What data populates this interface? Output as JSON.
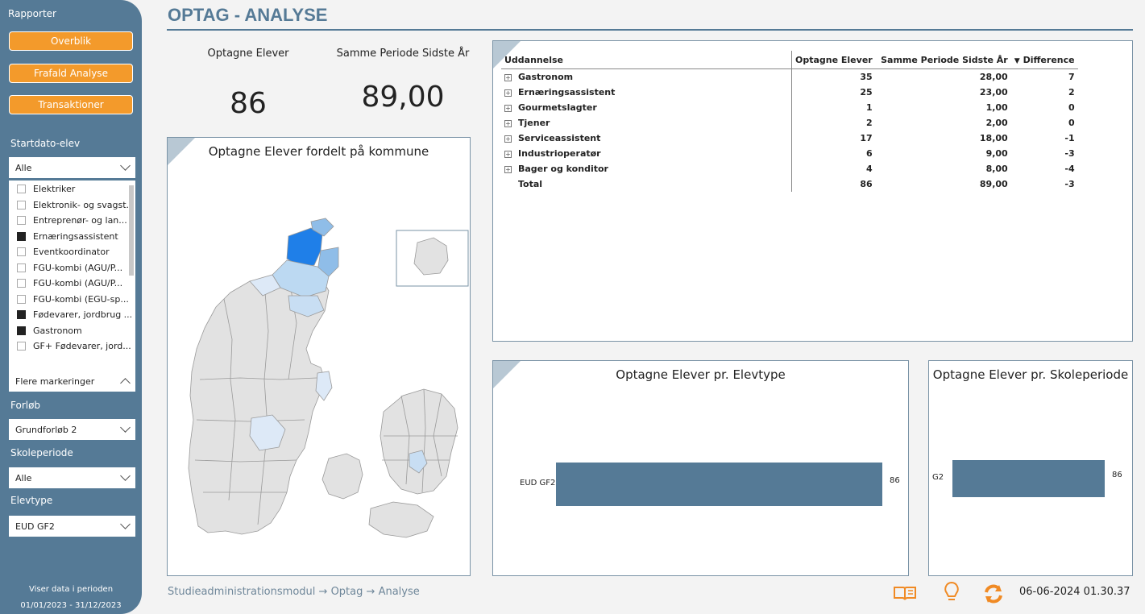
{
  "sidebar": {
    "header": "Rapporter",
    "nav": [
      "Overblik",
      "Frafald Analyse",
      "Transaktioner"
    ],
    "filters": {
      "startdato_label": "Startdato-elev",
      "startdato_value": "Alle",
      "education_list": [
        {
          "label": "Elektriker",
          "checked": false
        },
        {
          "label": "Elektronik- og svagst...",
          "checked": false
        },
        {
          "label": "Entreprenør- og lan...",
          "checked": false
        },
        {
          "label": "Ernæringsassistent",
          "checked": true
        },
        {
          "label": "Eventkoordinator",
          "checked": false
        },
        {
          "label": "FGU-kombi (AGU/P...",
          "checked": false
        },
        {
          "label": "FGU-kombi (AGU/P...",
          "checked": false
        },
        {
          "label": "FGU-kombi (EGU-sp...",
          "checked": false
        },
        {
          "label": "Fødevarer, jordbrug ...",
          "checked": true
        },
        {
          "label": "Gastronom",
          "checked": true
        },
        {
          "label": "GF+ Fødevarer, jord...",
          "checked": false
        }
      ],
      "multi_select_value": "Flere markeringer",
      "forloeb_label": "Forløb",
      "forloeb_value": "Grundforløb 2",
      "skoleperiode_label": "Skoleperiode",
      "skoleperiode_value": "Alle",
      "elevtype_label": "Elevtype",
      "elevtype_value": "EUD GF2"
    },
    "period_label": "Viser data i perioden",
    "period_range": "01/01/2023 - 31/12/2023"
  },
  "page": {
    "title": "OPTAG - ANALYSE"
  },
  "kpis": {
    "optagne_label": "Optagne Elever",
    "optagne_value": "86",
    "sidste_label": "Samme Periode Sidste År",
    "sidste_value": "89,00"
  },
  "map": {
    "title": "Optagne Elever fordelt på kommune"
  },
  "matrix": {
    "headers": [
      "Uddannelse",
      "Optagne Elever",
      "Samme Periode Sidste År",
      "Difference"
    ],
    "rows": [
      {
        "name": "Gastronom",
        "optagne": "35",
        "sidste": "28,00",
        "diff": "7"
      },
      {
        "name": "Ernæringsassistent",
        "optagne": "25",
        "sidste": "23,00",
        "diff": "2"
      },
      {
        "name": "Gourmetslagter",
        "optagne": "1",
        "sidste": "1,00",
        "diff": "0"
      },
      {
        "name": "Tjener",
        "optagne": "2",
        "sidste": "2,00",
        "diff": "0"
      },
      {
        "name": "Serviceassistent",
        "optagne": "17",
        "sidste": "18,00",
        "diff": "-1"
      },
      {
        "name": "Industrioperatør",
        "optagne": "6",
        "sidste": "9,00",
        "diff": "-3"
      },
      {
        "name": "Bager og konditor",
        "optagne": "4",
        "sidste": "8,00",
        "diff": "-4"
      }
    ],
    "total": {
      "name": "Total",
      "optagne": "86",
      "sidste": "89,00",
      "diff": "-3"
    }
  },
  "chart_data": [
    {
      "type": "bar",
      "orientation": "horizontal",
      "title": "Optagne Elever pr. Elevtype",
      "categories": [
        "EUD GF2"
      ],
      "values": [
        86
      ],
      "xlim": [
        0,
        86
      ]
    },
    {
      "type": "bar",
      "orientation": "horizontal",
      "title": "Optagne Elever pr. Skoleperiode",
      "categories": [
        "G2"
      ],
      "values": [
        86
      ],
      "xlim": [
        0,
        86
      ]
    }
  ],
  "breadcrumb": {
    "items": [
      "Studieadministrationsmodul",
      "Optag",
      "Analyse"
    ],
    "separator": "→"
  },
  "footer": {
    "icons": [
      "book-icon",
      "lightbulb-icon",
      "refresh-icon"
    ],
    "timestamp": "06-06-2024 01.30.37"
  },
  "colors": {
    "sidebar": "#557a96",
    "nav_button": "#f39a2b",
    "bar": "#557a96",
    "map_highlight": "#1f7fe8",
    "map_base": "#e2e2e2"
  }
}
